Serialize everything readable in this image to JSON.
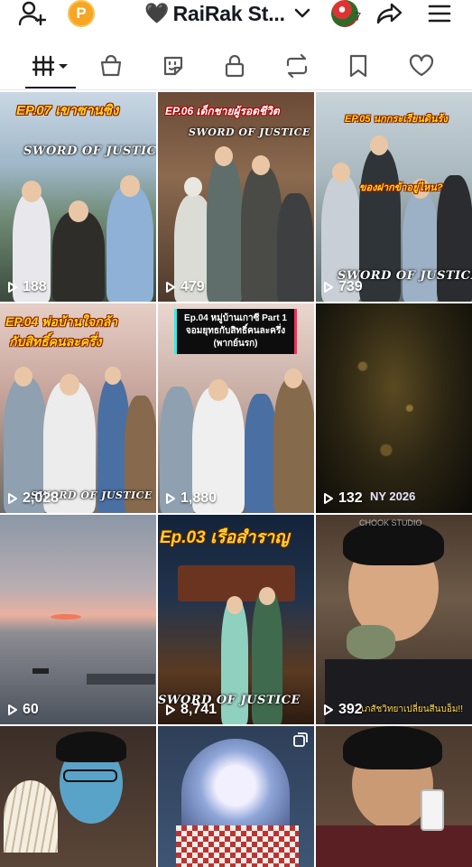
{
  "header": {
    "points_letter": "P",
    "account_title": "RaiRak St...",
    "heart_glyph": "🖤",
    "badge_count": "7",
    "icons": [
      "add-user-icon",
      "points-coin-icon",
      "chevron-down-icon",
      "avatar-icon",
      "share-icon",
      "menu-icon"
    ]
  },
  "tabs": {
    "items": [
      "videos-grid",
      "shop",
      "favorites-sticker",
      "private",
      "reposts",
      "saved",
      "liked"
    ],
    "active": "videos-grid"
  },
  "videos": [
    {
      "title": "EP.07 เขาซานซิง",
      "brand": "SWORD OF JUSTICE",
      "views": "188"
    },
    {
      "title": "EP.06 เด็กชายผู้รอดชีวิต",
      "brand": "SWORD OF JUSTICE",
      "views": "479"
    },
    {
      "title": "EP.05 นกกระเรียนดินร้ง",
      "subtitle": "ของฝากข้าอยู่ไหน?",
      "brand": "SWORD OF JUSTICE",
      "views": "739"
    },
    {
      "title": "EP.04 พ่อบ้านใจกล้า",
      "title2": "กับสิทธิ์คนละครึ่ง",
      "brand": "SWORD OF JUSTICE",
      "views": "2,028"
    },
    {
      "caption": "Ep.04 หมู่บ้านเกาซี Part 1 จอมยุทธกับสิทธิ์คนละครึ่ง (พากย์นรก)",
      "views": "1,880"
    },
    {
      "overlay": "NY 2026",
      "views": "132"
    },
    {
      "views": "60"
    },
    {
      "title": "Ep.03 เรือสำราญ",
      "brand": "SWORD OF JUSTICE",
      "views": "8,741"
    },
    {
      "watermark": "CHOOK STUDIO",
      "subtitle": "เภสัชวิทยาเปลี่ยนสีนบอ็ม!!",
      "views": "392"
    },
    {
      "views": ""
    },
    {
      "views": ""
    },
    {
      "views": ""
    }
  ],
  "colors": {
    "accent_text": "#161823",
    "title_yellow": "#ffd21f",
    "coin": "#f6a623"
  }
}
